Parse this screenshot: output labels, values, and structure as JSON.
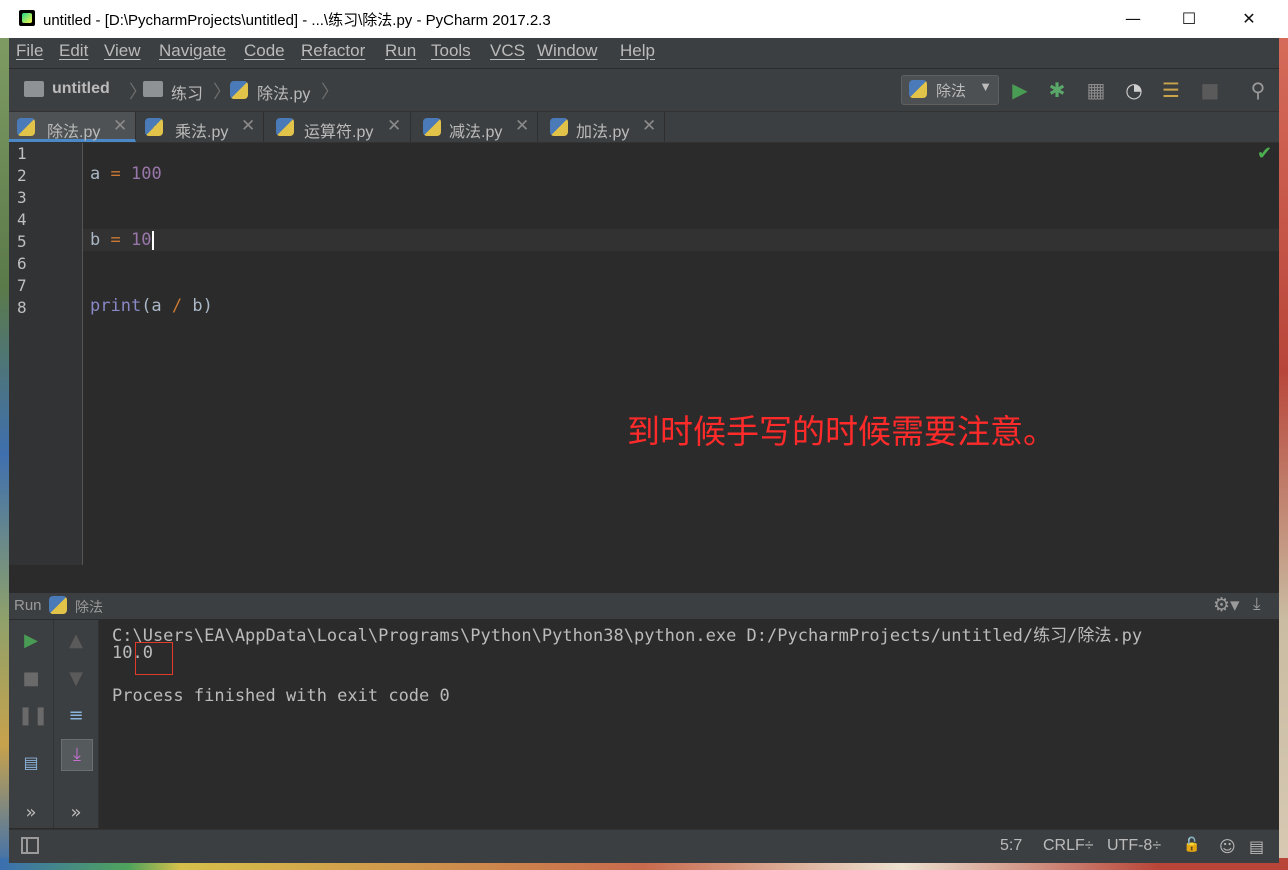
{
  "window": {
    "title": "untitled - [D:\\PycharmProjects\\untitled] - ...\\练习\\除法.py - PyCharm 2017.2.3",
    "minimize_glyph": "—",
    "maximize_glyph": "☐",
    "close_glyph": "✕"
  },
  "menu": [
    "File",
    "Edit",
    "View",
    "Navigate",
    "Code",
    "Refactor",
    "Run",
    "Tools",
    "VCS",
    "Window",
    "Help"
  ],
  "breadcrumb": {
    "project": "untitled",
    "folder": "练习",
    "file": "除法.py"
  },
  "run_config": {
    "label": "除法",
    "arrow": "▼"
  },
  "toolbar_icons": [
    "run-icon",
    "debug-icon",
    "coverage-icon",
    "profile-icon",
    "build-icon",
    "stop-icon",
    "search-icon"
  ],
  "tabs": [
    {
      "label": "除法.py",
      "active": true,
      "close": "✕"
    },
    {
      "label": "乘法.py",
      "active": false,
      "close": "✕"
    },
    {
      "label": "运算符.py",
      "active": false,
      "close": "✕"
    },
    {
      "label": "减法.py",
      "active": false,
      "close": "✕"
    },
    {
      "label": "加法.py",
      "active": false,
      "close": "✕"
    }
  ],
  "editor": {
    "line_numbers": [
      "1",
      "2",
      "3",
      "4",
      "5",
      "6",
      "7",
      "8"
    ],
    "line2": {
      "var": "a",
      "op": " = ",
      "num": "100"
    },
    "line5": {
      "var": "b",
      "op": " = ",
      "num": "10"
    },
    "line8": {
      "fn": "print",
      "open": "(a ",
      "op": "/",
      "close": " b)"
    },
    "current_line": 5,
    "inspection": "✔"
  },
  "annotation": "到时候手写的时候需要注意。",
  "run_panel": {
    "title": "Run",
    "file": "除法",
    "command": "C:\\Users\\EA\\AppData\\Local\\Programs\\Python\\Python38\\python.exe D:/PycharmProjects/untitled/练习/除法.py",
    "output": "10.0",
    "finished": "Process finished with exit code 0",
    "gear_glyph": "⚙▾",
    "hide_glyph": "⤓",
    "more_glyph": "»"
  },
  "status": {
    "position": "5:7",
    "line_sep": "CRLF÷",
    "encoding": "UTF-8÷",
    "lock_glyph": "🔓",
    "inspector_glyph": "☺",
    "event_glyph": "▤"
  },
  "colors": {
    "editor_bg": "#2b2b2b",
    "panel_bg": "#3c3f41",
    "keyword_operator": "#cc7832",
    "number": "#9876aa",
    "builtin": "#8888c6",
    "annotation_red": "#ff2a2a",
    "run_green": "#499c54"
  }
}
